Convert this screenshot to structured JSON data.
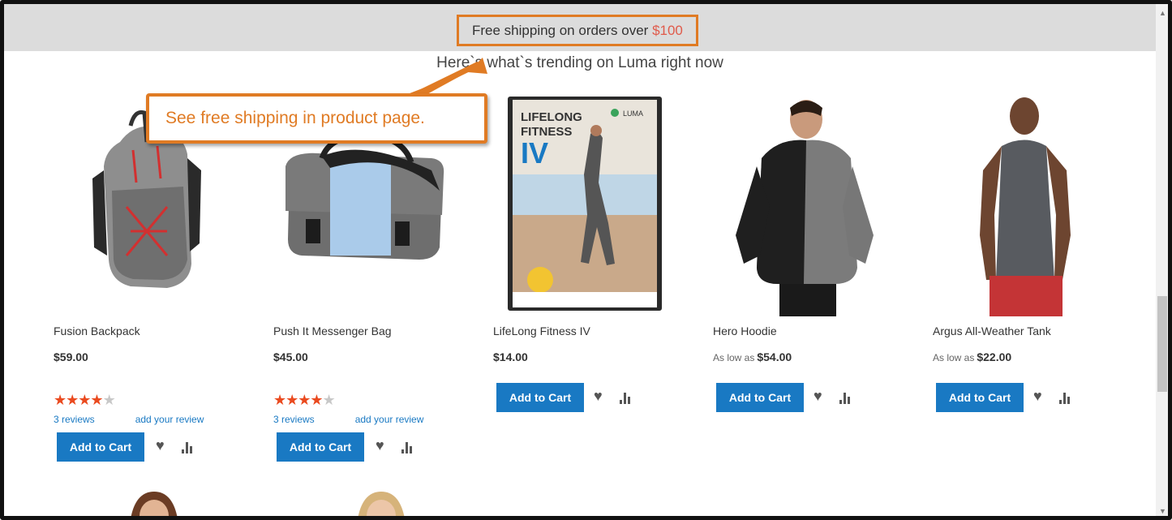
{
  "banner": {
    "text": "Free shipping on orders over ",
    "amount": "$100"
  },
  "heading": "Here`s what`s trending on Luma right now",
  "callout": "See free shipping in product page.",
  "colors": {
    "accent": "#e07b24",
    "button": "#1979c3",
    "star": "#ea4a1f"
  },
  "products": [
    {
      "name": "Fusion Backpack",
      "price": "$59.00",
      "rating": 3.5,
      "reviews": "3  reviews",
      "add_review": "add your review",
      "add_to_cart": "Add to Cart"
    },
    {
      "name": "Push It Messenger Bag",
      "price": "$45.00",
      "rating": 3.5,
      "reviews": "3  reviews",
      "add_review": "add your review",
      "add_to_cart": "Add to Cart"
    },
    {
      "name": "LifeLong Fitness IV",
      "price": "$14.00",
      "add_to_cart": "Add to Cart"
    },
    {
      "name": "Hero Hoodie",
      "price_prefix": "As low as",
      "price": "$54.00",
      "add_to_cart": "Add to Cart"
    },
    {
      "name": "Argus All-Weather Tank",
      "price_prefix": "As low as",
      "price": "$22.00",
      "add_to_cart": "Add to Cart"
    }
  ],
  "dvd": {
    "title_line1": "LIFELONG",
    "title_line2": "FITNESS",
    "title_num": "IV",
    "brand": "LUMA"
  },
  "icons": {
    "wishlist": "heart-icon",
    "compare": "compare-icon"
  }
}
